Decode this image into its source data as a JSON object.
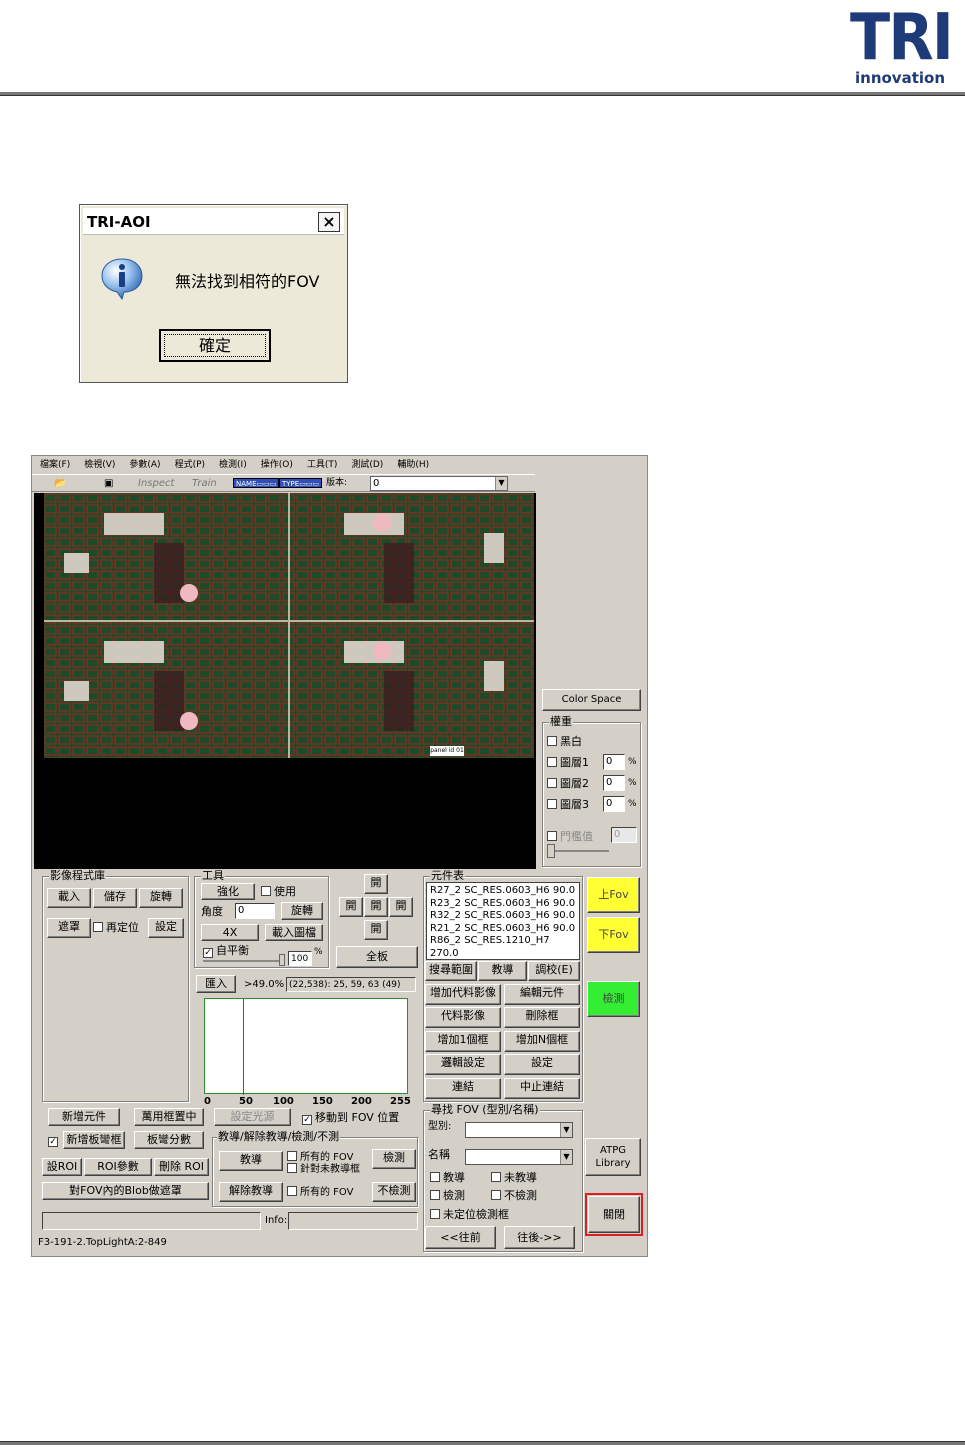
{
  "header": {
    "logo_main": "TRI",
    "logo_sub": "innovation"
  },
  "dialog": {
    "title": "TRI-AOI",
    "close": "×",
    "message": "無法找到相符的FOV",
    "ok_label": "確定"
  },
  "app": {
    "menu": [
      "檔案(F)",
      "檢視(V)",
      "參數(A)",
      "程式(P)",
      "檢測(I)",
      "操作(O)",
      "工具(T)",
      "測試(D)",
      "輔助(H)"
    ],
    "toolbar": {
      "inspect": "Inspect",
      "train": "Train",
      "chip1": "NAME▭▭▭",
      "chip2": "TYPE▭▭▭",
      "version_label": "版本:",
      "version_value": "0"
    },
    "pcb_label": "panel id 01",
    "right_panel": {
      "color_space": "Color Space",
      "weight_group": "權重",
      "mono": "黑白",
      "layer1": "圖層1",
      "layer2": "圖層2",
      "layer3": "圖層3",
      "layer1_value": "0",
      "layer2_value": "0",
      "layer3_value": "0",
      "pct": "%",
      "threshold": "門檻值",
      "threshold_value": "0"
    },
    "image_lib": {
      "title": "影像程式庫",
      "load": "載入",
      "save": "儲存",
      "rotate": "旋轉",
      "mask": "遮罩",
      "reposition": "再定位",
      "settings": "設定"
    },
    "tools": {
      "title": "工具",
      "enhance": "強化",
      "use": "使用",
      "angle_label": "角度",
      "angle_value": "0",
      "rotate": "旋轉",
      "zoom": "4X",
      "load_image": "載入圖檔",
      "auto_balance": "自平衡",
      "balance_value": "100",
      "pct": "%",
      "open_top": "開",
      "open_left": "開",
      "open_mid": "開",
      "open_right": "開",
      "open_bottom": "開",
      "full_board": "全板"
    },
    "histogram": {
      "import": "匯入",
      "ratio": ">49.0%",
      "readout": "(22,538): 25, 59, 63 (49)",
      "ticks": [
        "0",
        "50",
        "100",
        "150",
        "200",
        "255"
      ]
    },
    "components": {
      "title": "元件表",
      "items": [
        "R27_2 SC_RES.0603_H6 90.0",
        "R23_2 SC_RES.0603_H6 90.0",
        "R32_2 SC_RES.0603_H6 90.0",
        "R21_2 SC_RES.0603_H6 90.0",
        "R86_2 SC_RES.1210_H7 270.0"
      ],
      "search_range": "搜尋範圍",
      "teach": "教導",
      "calibrate": "調校(E)",
      "add_replace": "增加代料影像",
      "edit": "編輯元件",
      "replace_image": "代料影像",
      "delete_box": "刪除框",
      "add_one": "增加1個框",
      "add_n": "增加N個框",
      "logic_settings": "邏輯設定",
      "setup": "設定",
      "connect": "連結",
      "stop_connect": "中止連結"
    },
    "side_buttons": {
      "up_fov": "上Fov",
      "down_fov": "下Fov",
      "inspect": "檢測",
      "atpg": "ATPG Library",
      "close": "關閉"
    },
    "bottom_left": {
      "add_component": "新增元件",
      "universal_center": "萬用框置中",
      "set_light": "設定光源",
      "move_fov": "移動到 FOV 位置",
      "new_board_warp": "新增板彎框",
      "warp_score": "板彎分數",
      "teach_group": "教導/解除教導/檢測/不測",
      "set_roi": "設ROI",
      "roi_params": "ROI參數",
      "delete_roi": "刪除 ROI",
      "teach": "教導",
      "all_fov": "所有的 FOV",
      "untaught_only": "針對未教導框",
      "inspect": "檢測",
      "blob_fov": "對FOV內的Blob做遮罩",
      "untrain": "解除教導",
      "all_fov2": "所有的 FOV",
      "no_inspect": "不檢測",
      "info_label": "Info:",
      "status": "F3-191-2.TopLightA:2-849"
    },
    "find_fov": {
      "title": "尋找 FOV (型別/名稱)",
      "type_label": "型別:",
      "name_label": "名稱",
      "taught": "教導",
      "untaught": "未教導",
      "inspected": "檢測",
      "not_inspected": "不檢測",
      "unlocated": "未定位檢測框",
      "prev": "<<往前",
      "next": "往後->>"
    }
  }
}
